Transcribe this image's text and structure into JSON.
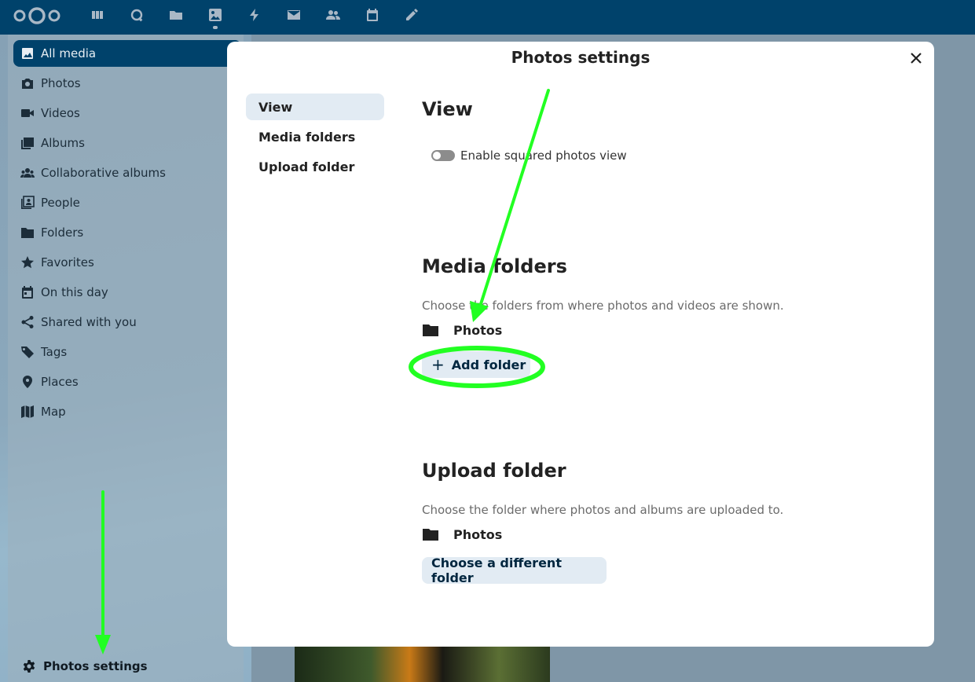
{
  "header": {
    "apps": [
      {
        "name": "dashboard-icon"
      },
      {
        "name": "search-icon"
      },
      {
        "name": "files-icon"
      },
      {
        "name": "photos-icon"
      },
      {
        "name": "activity-icon"
      },
      {
        "name": "mail-icon"
      },
      {
        "name": "contacts-icon"
      },
      {
        "name": "calendar-icon"
      },
      {
        "name": "notes-icon"
      }
    ]
  },
  "sidebar": {
    "items": [
      {
        "label": "All media",
        "icon": "image-icon"
      },
      {
        "label": "Photos",
        "icon": "camera-icon"
      },
      {
        "label": "Videos",
        "icon": "video-icon"
      },
      {
        "label": "Albums",
        "icon": "albums-icon"
      },
      {
        "label": "Collaborative albums",
        "icon": "group-icon"
      },
      {
        "label": "People",
        "icon": "people-icon"
      },
      {
        "label": "Folders",
        "icon": "folder-icon"
      },
      {
        "label": "Favorites",
        "icon": "star-icon"
      },
      {
        "label": "On this day",
        "icon": "calendar-icon"
      },
      {
        "label": "Shared with you",
        "icon": "share-icon"
      },
      {
        "label": "Tags",
        "icon": "tag-icon"
      },
      {
        "label": "Places",
        "icon": "map-pin-icon"
      },
      {
        "label": "Map",
        "icon": "map-icon"
      }
    ],
    "settings_label": "Photos settings"
  },
  "modal": {
    "title": "Photos settings",
    "nav": [
      "View",
      "Media folders",
      "Upload folder"
    ],
    "view": {
      "title": "View",
      "toggle_label": "Enable squared photos view"
    },
    "media_folders": {
      "title": "Media folders",
      "description": "Choose the folders from where photos and videos are shown.",
      "folder": "Photos",
      "add_button": "Add folder"
    },
    "upload_folder": {
      "title": "Upload folder",
      "description": "Choose the folder where photos and albums are uploaded to.",
      "folder": "Photos",
      "choose_button": "Choose a different folder"
    }
  },
  "colors": {
    "header": "#00426b",
    "annotation": "#22ff22"
  }
}
